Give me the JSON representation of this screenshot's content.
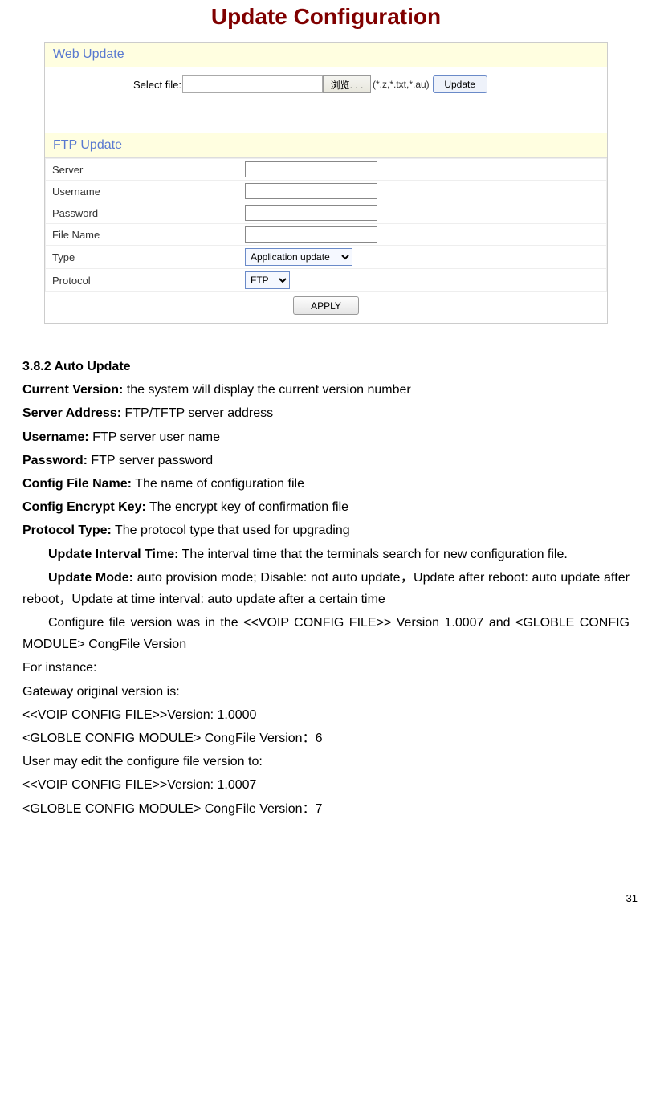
{
  "pageTitle": "Update Configuration",
  "webUpdate": {
    "header": "Web Update",
    "selectFileLabel": "Select file:",
    "browseLabel": "浏览. . .",
    "fileTypes": "(*.z,*.txt,*.au)",
    "updateBtn": "Update"
  },
  "ftpUpdate": {
    "header": "FTP Update",
    "rows": {
      "server": "Server",
      "username": "Username",
      "password": "Password",
      "filename": "File Name",
      "type": "Type",
      "protocol": "Protocol"
    },
    "typeValue": "Application update",
    "protocolValue": "FTP",
    "applyBtn": "APPLY"
  },
  "doc": {
    "sectionHead": "3.8.2 Auto Update",
    "p1a": "Current Version:",
    "p1b": " the system will display the current version number",
    "p2a": "Server Address:",
    "p2b": " FTP/TFTP server address",
    "p3a": "Username:",
    "p3b": " FTP server user name",
    "p4a": "Password:",
    "p4b": " FTP server password",
    "p5a": "Config File Name:",
    "p5b": " The name of configuration file",
    "p6a": "Config Encrypt Key:",
    "p6b": " The encrypt key of confirmation file",
    "p7a": "Protocol Type:",
    "p7b": " The protocol type that used for upgrading",
    "p8a": "Update Interval Time:",
    "p8b": " The interval time that the terminals search for new configuration file.",
    "p9a": "Update Mode:",
    "p9b": " auto provision mode; Disable: not auto update，Update after reboot: auto update after reboot，Update at time interval: auto update after a certain time",
    "p10": "Configure file version was in the <<VOIP CONFIG FILE>> Version 1.0007 and <GLOBLE CONFIG MODULE> CongFile Version",
    "p11": "For instance:",
    "p12": "Gateway original version is:",
    "p13": "<<VOIP CONFIG FILE>>Version: 1.0000",
    "p14": "<GLOBLE CONFIG MODULE>   CongFile Version：6",
    "p15": "User may edit the configure file version to:",
    "p16": "<<VOIP CONFIG FILE>>Version: 1.0007",
    "p17": "<GLOBLE CONFIG MODULE>   CongFile Version：7"
  },
  "pageNumber": "31"
}
